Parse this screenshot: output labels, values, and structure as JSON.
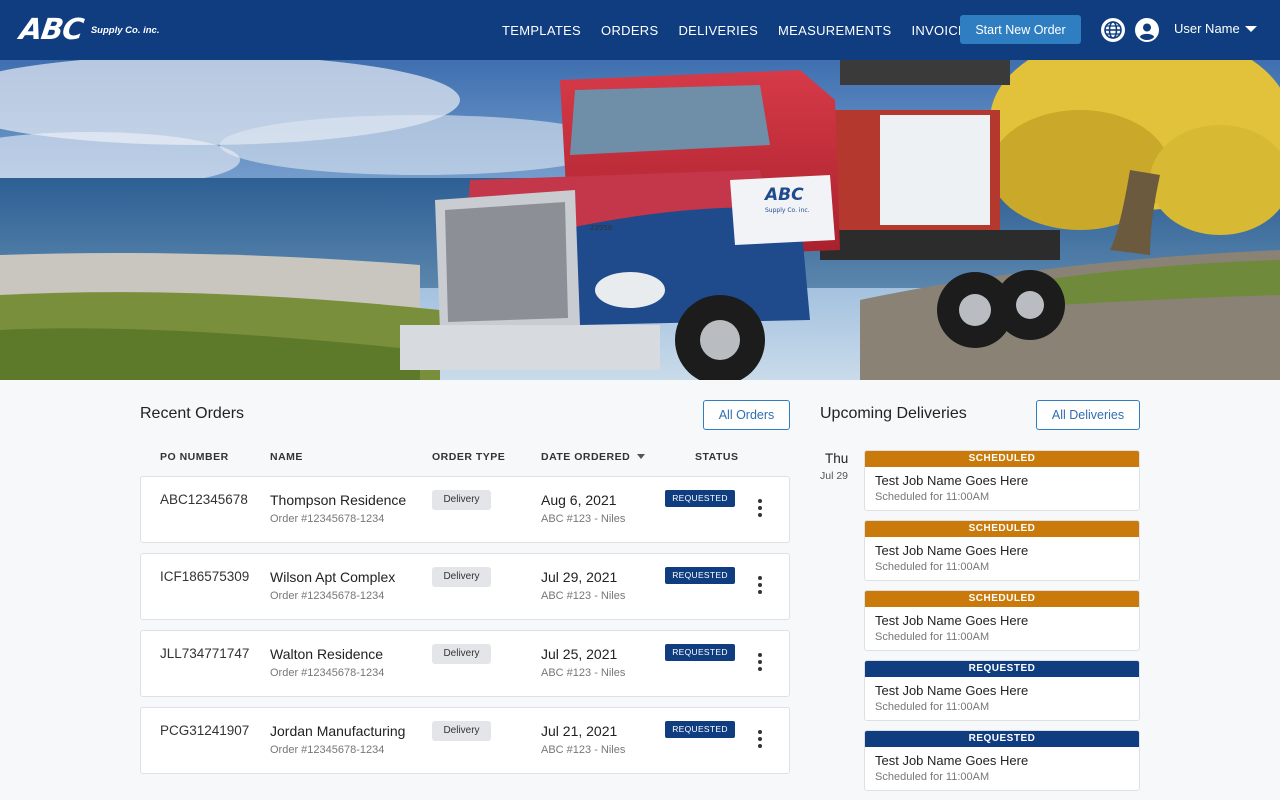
{
  "brand": {
    "name": "ABC",
    "tagline": "Supply Co. inc."
  },
  "nav": {
    "items": [
      "TEMPLATES",
      "ORDERS",
      "DELIVERIES",
      "MEASUREMENTS",
      "INVOICES"
    ],
    "start_button": "Start New Order",
    "user_name": "User Name"
  },
  "hero": {
    "truck_badge": "ABC",
    "truck_badge_sub": "Supply Co. inc.",
    "truck_number": "22958"
  },
  "orders": {
    "title": "Recent Orders",
    "all_button": "All Orders",
    "columns": [
      "PO NUMBER",
      "NAME",
      "ORDER TYPE",
      "DATE ORDERED",
      "STATUS"
    ],
    "rows": [
      {
        "po": "ABC12345678",
        "name": "Thompson Residence",
        "order_no": "Order #12345678-1234",
        "type": "Delivery",
        "date": "Aug 6, 2021",
        "branch": "ABC #123 - Niles",
        "status": "REQUESTED"
      },
      {
        "po": "ICF186575309",
        "name": "Wilson Apt Complex",
        "order_no": "Order #12345678-1234",
        "type": "Delivery",
        "date": "Jul 29, 2021",
        "branch": "ABC #123 - Niles",
        "status": "REQUESTED"
      },
      {
        "po": "JLL734771747",
        "name": "Walton Residence",
        "order_no": "Order #12345678-1234",
        "type": "Delivery",
        "date": "Jul 25, 2021",
        "branch": "ABC #123 - Niles",
        "status": "REQUESTED"
      },
      {
        "po": "PCG31241907",
        "name": "Jordan Manufacturing",
        "order_no": "Order #12345678-1234",
        "type": "Delivery",
        "date": "Jul 21, 2021",
        "branch": "ABC #123 - Niles",
        "status": "REQUESTED"
      }
    ]
  },
  "deliveries": {
    "title": "Upcoming Deliveries",
    "all_button": "All Deliveries",
    "day": "Thu",
    "date": "Jul 29",
    "items": [
      {
        "status": "SCHEDULED",
        "color": "#c97a0a",
        "job": "Test Job Name Goes Here",
        "time": "Scheduled for 11:00AM"
      },
      {
        "status": "SCHEDULED",
        "color": "#c97a0a",
        "job": "Test Job Name Goes Here",
        "time": "Scheduled for 11:00AM"
      },
      {
        "status": "SCHEDULED",
        "color": "#c97a0a",
        "job": "Test Job Name Goes Here",
        "time": "Scheduled for 11:00AM"
      },
      {
        "status": "REQUESTED",
        "color": "#0f3d7f",
        "job": "Test Job Name Goes Here",
        "time": "Scheduled for 11:00AM"
      },
      {
        "status": "REQUESTED",
        "color": "#0f3d7f",
        "job": "Test Job Name Goes Here",
        "time": "Scheduled for 11:00AM"
      }
    ]
  },
  "colors": {
    "navy": "#0f3d7f",
    "accent": "#2f7ec1",
    "scheduled": "#c97a0a"
  }
}
